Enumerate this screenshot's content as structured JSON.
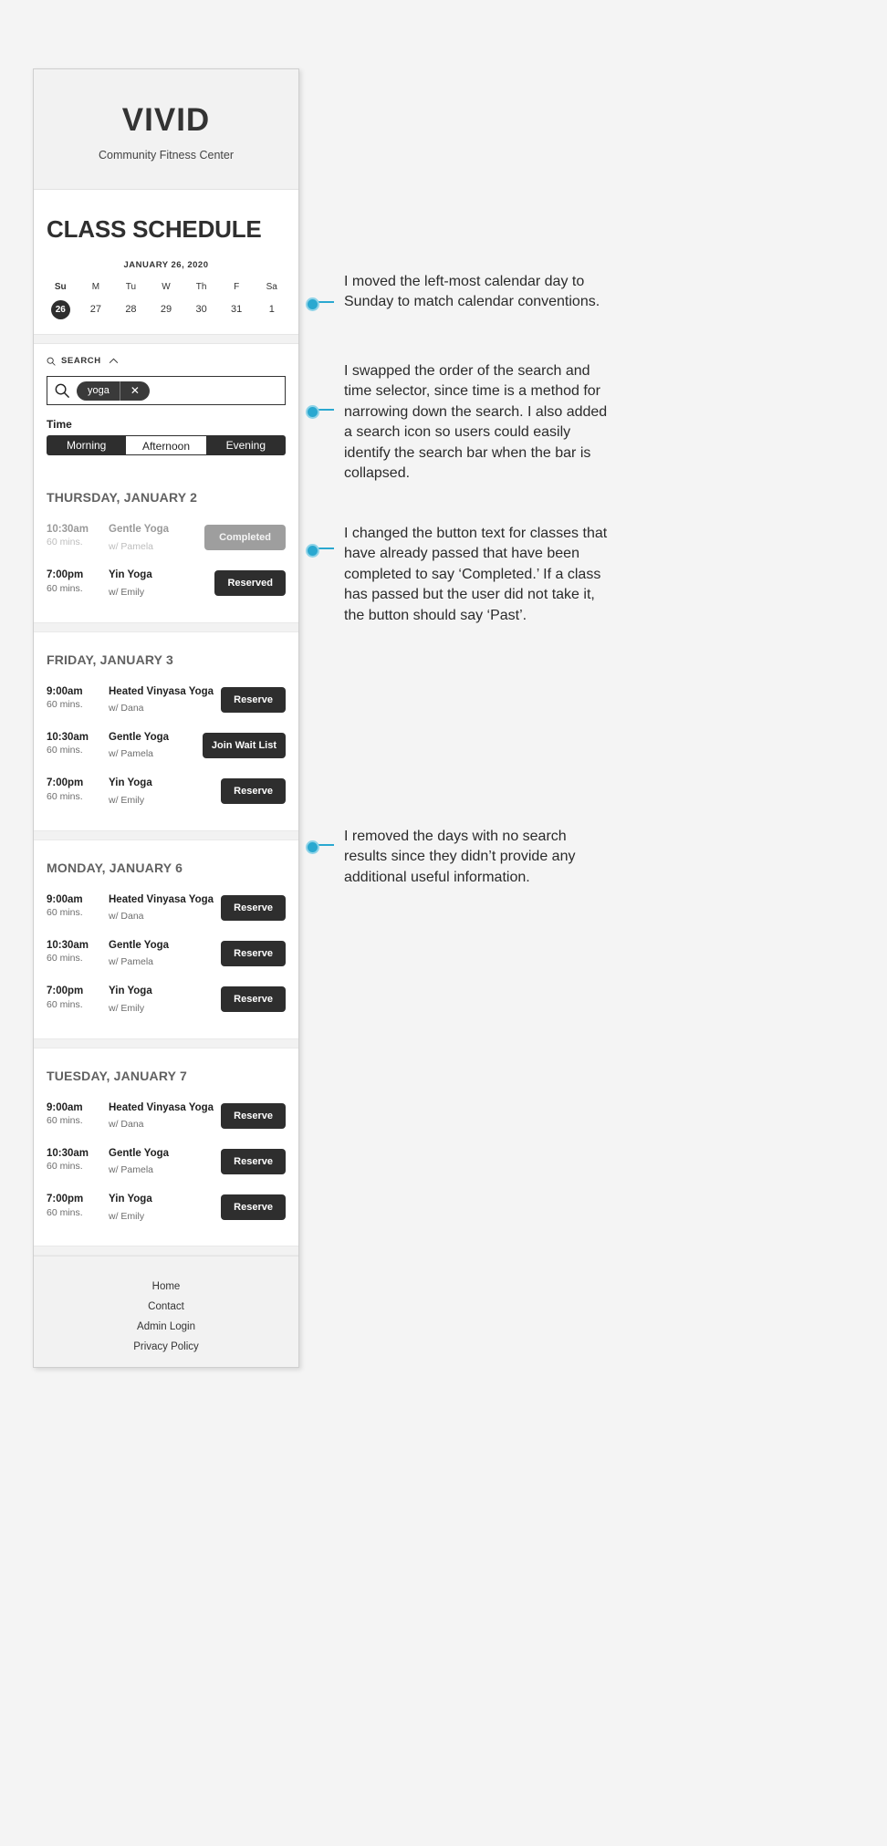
{
  "app": {
    "brand": "VIVID",
    "tagline": "Community Fitness Center",
    "page_title": "CLASS SCHEDULE"
  },
  "calendar": {
    "month_label": "JANUARY 26, 2020",
    "days": [
      {
        "dow": "Su",
        "num": "26",
        "selected": true
      },
      {
        "dow": "M",
        "num": "27",
        "selected": false
      },
      {
        "dow": "Tu",
        "num": "28",
        "selected": false
      },
      {
        "dow": "W",
        "num": "29",
        "selected": false
      },
      {
        "dow": "Th",
        "num": "30",
        "selected": false
      },
      {
        "dow": "F",
        "num": "31",
        "selected": false
      },
      {
        "dow": "Sa",
        "num": "1",
        "selected": false
      }
    ]
  },
  "search": {
    "header_label": "SEARCH",
    "collapse_icon": "chevron-up-icon",
    "search_icon": "search-icon",
    "chip_value": "yoga",
    "clear_icon": "close-icon",
    "time_label": "Time",
    "time_options": [
      {
        "label": "Morning",
        "selected": true
      },
      {
        "label": "Afternoon",
        "selected": false
      },
      {
        "label": "Evening",
        "selected": true
      }
    ]
  },
  "schedule": [
    {
      "day": "THURSDAY, JANUARY 2",
      "classes": [
        {
          "time": "10:30am",
          "duration": "60 mins.",
          "name": "Gentle Yoga",
          "instructor": "w/ Pamela",
          "action": "Completed",
          "state": "completed"
        },
        {
          "time": "7:00pm",
          "duration": "60 mins.",
          "name": "Yin Yoga",
          "instructor": "w/ Emily",
          "action": "Reserved",
          "state": "reserved"
        }
      ]
    },
    {
      "day": "FRIDAY, JANUARY 3",
      "classes": [
        {
          "time": "9:00am",
          "duration": "60 mins.",
          "name": "Heated Vinyasa Yoga",
          "instructor": "w/ Dana",
          "action": "Reserve",
          "state": "available"
        },
        {
          "time": "10:30am",
          "duration": "60 mins.",
          "name": "Gentle Yoga",
          "instructor": "w/ Pamela",
          "action": "Join Wait List",
          "state": "waitlist"
        },
        {
          "time": "7:00pm",
          "duration": "60 mins.",
          "name": "Yin Yoga",
          "instructor": "w/ Emily",
          "action": "Reserve",
          "state": "available"
        }
      ]
    },
    {
      "day": "MONDAY, JANUARY 6",
      "classes": [
        {
          "time": "9:00am",
          "duration": "60 mins.",
          "name": "Heated Vinyasa Yoga",
          "instructor": "w/ Dana",
          "action": "Reserve",
          "state": "available"
        },
        {
          "time": "10:30am",
          "duration": "60 mins.",
          "name": "Gentle Yoga",
          "instructor": "w/ Pamela",
          "action": "Reserve",
          "state": "available"
        },
        {
          "time": "7:00pm",
          "duration": "60 mins.",
          "name": "Yin Yoga",
          "instructor": "w/ Emily",
          "action": "Reserve",
          "state": "available"
        }
      ]
    },
    {
      "day": "TUESDAY, JANUARY 7",
      "classes": [
        {
          "time": "9:00am",
          "duration": "60 mins.",
          "name": "Heated Vinyasa Yoga",
          "instructor": "w/ Dana",
          "action": "Reserve",
          "state": "available"
        },
        {
          "time": "10:30am",
          "duration": "60 mins.",
          "name": "Gentle Yoga",
          "instructor": "w/ Pamela",
          "action": "Reserve",
          "state": "available"
        },
        {
          "time": "7:00pm",
          "duration": "60 mins.",
          "name": "Yin Yoga",
          "instructor": "w/ Emily",
          "action": "Reserve",
          "state": "available"
        }
      ]
    }
  ],
  "footer": {
    "links": [
      "Home",
      "Contact",
      "Admin Login",
      "Privacy Policy"
    ]
  },
  "annotations": [
    {
      "text": "I moved the left-most calendar day to Sunday to match calendar conventions."
    },
    {
      "text": "I swapped the order of the search and time selector, since time is a method for narrowing down the search. I also added a search icon so users could easily identify the search bar when the bar is collapsed."
    },
    {
      "text": "I changed the button text for classes that have already passed that have been completed to say ‘Completed.’ If a class has passed but the user did not take it, the button should say ‘Past’."
    },
    {
      "text": "I removed the days with no search results since they didn’t provide any additional useful information."
    }
  ],
  "colors": {
    "accent": "#2aa8d0",
    "dark": "#2e2e2e",
    "muted": "#9e9e9e",
    "panel": "#f2f2f2"
  }
}
